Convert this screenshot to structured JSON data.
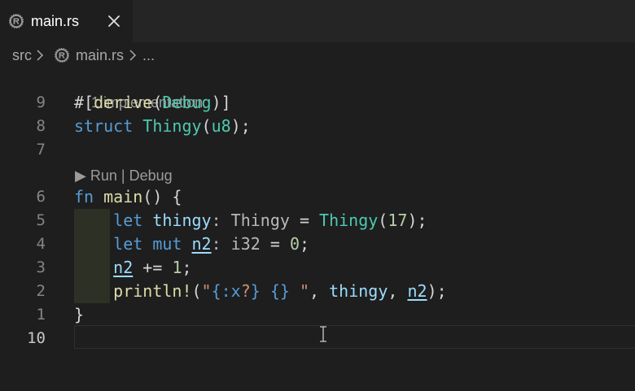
{
  "tab": {
    "label": "main.rs",
    "close_icon": "close-icon",
    "file_icon": "rust-icon"
  },
  "breadcrumb": {
    "folder": "src",
    "separator": ">",
    "file": "main.rs",
    "more": "..."
  },
  "lenses": {
    "implementations": "1 implementation",
    "run": "▶ Run",
    "sep": "|",
    "debug": "Debug"
  },
  "lines": [
    {
      "number": "9",
      "tokens": [
        {
          "c": "d",
          "t": "#["
        },
        {
          "c": "f",
          "t": "derive"
        },
        {
          "c": "d",
          "t": "("
        },
        {
          "c": "t",
          "t": "Debug"
        },
        {
          "c": "d",
          "t": ")]"
        }
      ]
    },
    {
      "number": "8",
      "tokens": [
        {
          "c": "k",
          "t": "struct "
        },
        {
          "c": "t",
          "t": "Thingy"
        },
        {
          "c": "d",
          "t": "("
        },
        {
          "c": "t",
          "t": "u8"
        },
        {
          "c": "d",
          "t": ");"
        }
      ]
    },
    {
      "number": "7",
      "tokens": []
    },
    {
      "number": "6",
      "tokens": [
        {
          "c": "k",
          "t": "fn "
        },
        {
          "c": "f",
          "t": "main"
        },
        {
          "c": "d",
          "t": "() {"
        }
      ]
    },
    {
      "number": "5",
      "tokens": [
        {
          "c": "d",
          "t": "    "
        },
        {
          "c": "k",
          "t": "let "
        },
        {
          "c": "v",
          "t": "thingy"
        },
        {
          "c": "ty",
          "t": ": Thingy"
        },
        {
          "c": "d",
          "t": " = "
        },
        {
          "c": "t",
          "t": "Thingy"
        },
        {
          "c": "d",
          "t": "("
        },
        {
          "c": "n",
          "t": "17"
        },
        {
          "c": "d",
          "t": ");"
        }
      ]
    },
    {
      "number": "4",
      "tokens": [
        {
          "c": "d",
          "t": "    "
        },
        {
          "c": "k",
          "t": "let mut "
        },
        {
          "c": "vu",
          "t": "n2"
        },
        {
          "c": "ty",
          "t": ": i32"
        },
        {
          "c": "d",
          "t": " = "
        },
        {
          "c": "n",
          "t": "0"
        },
        {
          "c": "d",
          "t": ";"
        }
      ]
    },
    {
      "number": "3",
      "tokens": [
        {
          "c": "d",
          "t": "    "
        },
        {
          "c": "vu",
          "t": "n2"
        },
        {
          "c": "d",
          "t": " += "
        },
        {
          "c": "n",
          "t": "1"
        },
        {
          "c": "d",
          "t": ";"
        }
      ]
    },
    {
      "number": "2",
      "tokens": [
        {
          "c": "d",
          "t": "    "
        },
        {
          "c": "mac",
          "t": "println!"
        },
        {
          "c": "d",
          "t": "("
        },
        {
          "c": "s",
          "t": "\""
        },
        {
          "c": "fmt",
          "t": "{:x"
        },
        {
          "c": "s",
          "t": "?"
        },
        {
          "c": "fmt",
          "t": "}"
        },
        {
          "c": "s",
          "t": " "
        },
        {
          "c": "fmt",
          "t": "{}"
        },
        {
          "c": "s",
          "t": " \""
        },
        {
          "c": "d",
          "t": ", "
        },
        {
          "c": "v",
          "t": "thingy"
        },
        {
          "c": "d",
          "t": ", "
        },
        {
          "c": "vu",
          "t": "n2"
        },
        {
          "c": "d",
          "t": ");"
        }
      ]
    },
    {
      "number": "1",
      "tokens": [
        {
          "c": "d",
          "t": "}"
        }
      ]
    },
    {
      "number": "10",
      "tokens": [],
      "current": true
    }
  ]
}
